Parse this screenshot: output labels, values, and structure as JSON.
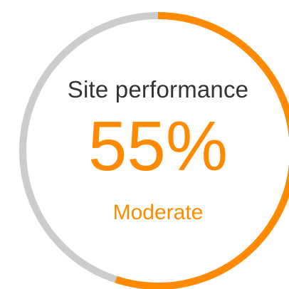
{
  "gauge": {
    "title": "Site performance",
    "value_text": "55%",
    "value": 55,
    "status": "Moderate",
    "colors": {
      "accent": "#ff8a00",
      "track": "#cccccc",
      "title": "#333333"
    }
  }
}
